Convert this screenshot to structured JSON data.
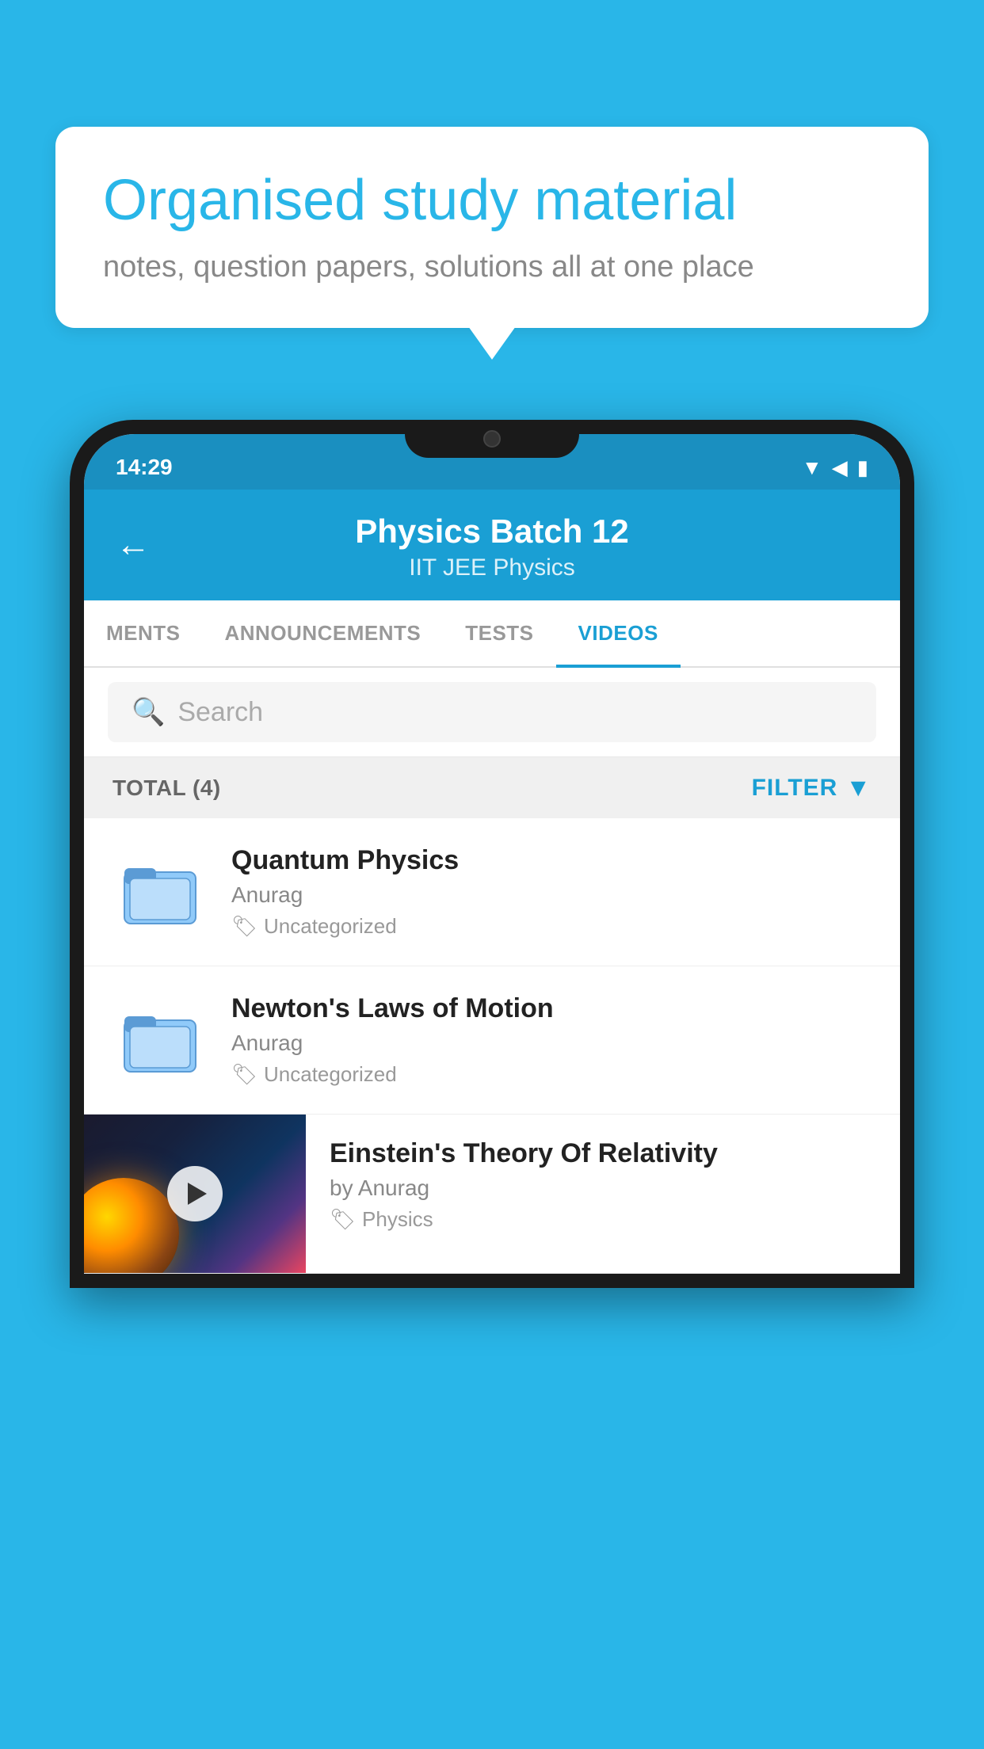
{
  "bubble": {
    "title": "Organised study material",
    "subtitle": "notes, question papers, solutions all at one place"
  },
  "statusBar": {
    "time": "14:29",
    "icons": [
      "wifi",
      "signal",
      "battery"
    ]
  },
  "header": {
    "title": "Physics Batch 12",
    "subtitle": "IIT JEE   Physics",
    "back_label": "←"
  },
  "tabs": [
    {
      "label": "MENTS",
      "active": false
    },
    {
      "label": "ANNOUNCEMENTS",
      "active": false
    },
    {
      "label": "TESTS",
      "active": false
    },
    {
      "label": "VIDEOS",
      "active": true
    }
  ],
  "search": {
    "placeholder": "Search"
  },
  "filter": {
    "total_label": "TOTAL (4)",
    "filter_label": "FILTER"
  },
  "videos": [
    {
      "title": "Quantum Physics",
      "author": "Anurag",
      "tag": "Uncategorized",
      "type": "folder"
    },
    {
      "title": "Newton's Laws of Motion",
      "author": "Anurag",
      "tag": "Uncategorized",
      "type": "folder"
    },
    {
      "title": "Einstein's Theory Of Relativity",
      "author": "by Anurag",
      "tag": "Physics",
      "type": "video"
    }
  ],
  "icons": {
    "search": "🔍",
    "filter": "▼",
    "tag": "🏷",
    "back": "←",
    "play": "▶"
  }
}
